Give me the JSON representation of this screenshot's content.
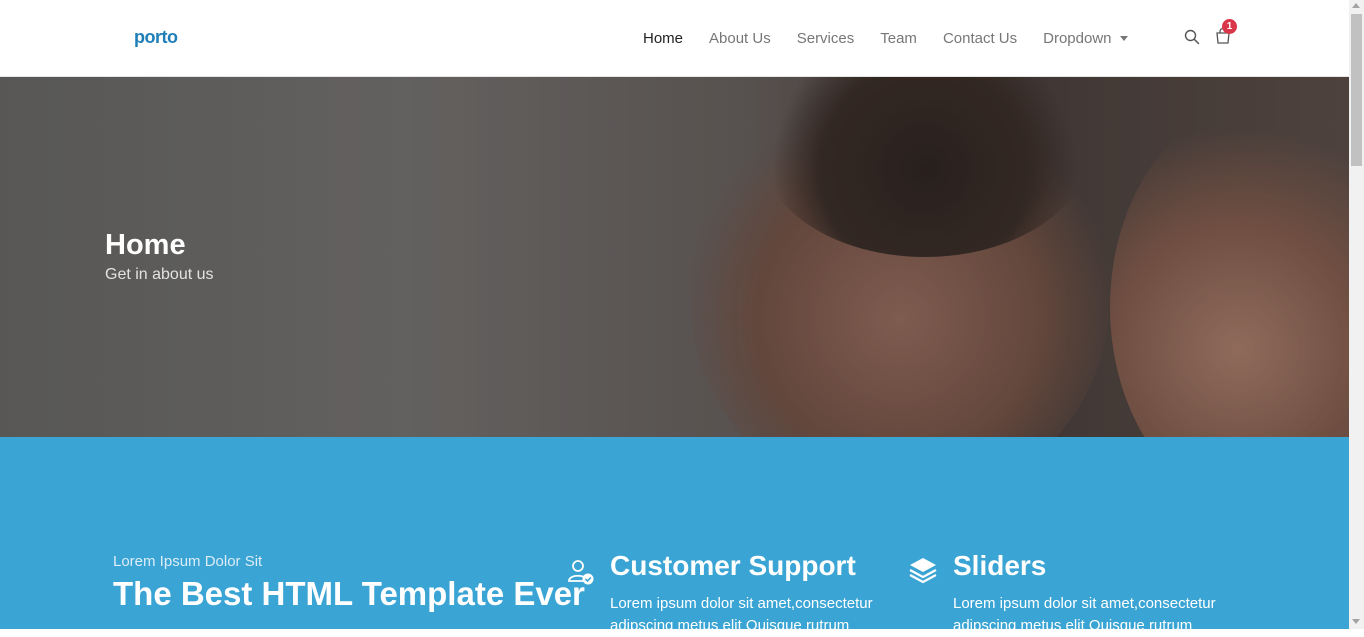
{
  "header": {
    "logo": "porto",
    "nav": [
      "Home",
      "About Us",
      "Services",
      "Team",
      "Contact Us",
      "Dropdown"
    ],
    "active_nav": "Home",
    "cart_count": "1",
    "icons": [
      "search-icon",
      "cart-icon"
    ]
  },
  "hero": {
    "title": "Home",
    "subtitle": "Get in about us"
  },
  "section": {
    "kicker": "Lorem Ipsum Dolor Sit",
    "title": "The Best HTML Template Ever",
    "features": [
      {
        "icon": "user-check-icon",
        "title": "Customer Support",
        "text": "Lorem ipsum dolor sit amet,consectetur adipscing metus elit Quisque rutrum"
      },
      {
        "icon": "layers-icon",
        "title": "Sliders",
        "text": "Lorem ipsum dolor sit amet,consectetur adipscing metus elit Quisque rutrum"
      }
    ]
  },
  "colors": {
    "accent": "#3aa4d4",
    "logo": "#1e7fb8",
    "badge": "#d9364a"
  }
}
